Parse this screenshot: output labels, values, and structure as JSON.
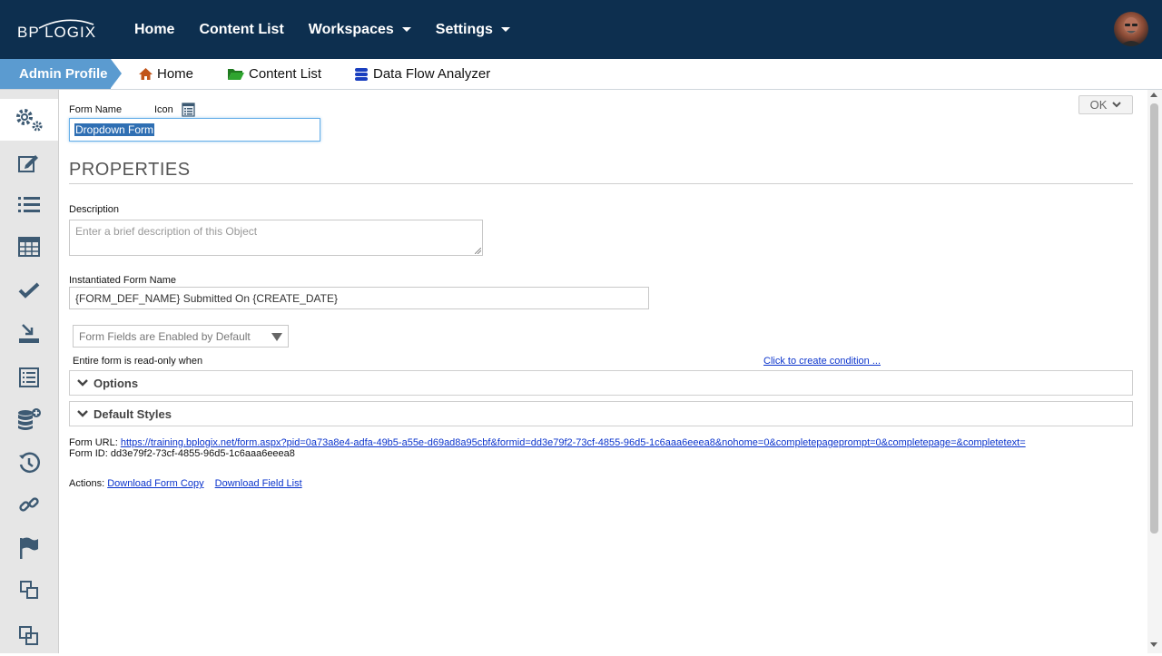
{
  "brand": {
    "logo_text": "BP LOGIX",
    "logo_icon": "bplogix-logo"
  },
  "topnav": {
    "items": [
      {
        "label": "Home",
        "has_caret": false
      },
      {
        "label": "Content List",
        "has_caret": false
      },
      {
        "label": "Workspaces",
        "has_caret": true
      },
      {
        "label": "Settings",
        "has_caret": true
      }
    ],
    "avatar_icon": "user-avatar"
  },
  "subnav": {
    "profile": "Admin Profile",
    "links": [
      {
        "label": "Home",
        "icon": "house-icon"
      },
      {
        "label": "Content List",
        "icon": "folder-icon"
      },
      {
        "label": "Data Flow Analyzer",
        "icon": "database-icon"
      }
    ]
  },
  "sidebar": {
    "icons": [
      "gears-icon",
      "edit-icon",
      "list-icon",
      "table-icon",
      "check-icon",
      "import-icon",
      "form-list-icon",
      "database-add-icon",
      "history-icon",
      "link-icon",
      "flag-icon",
      "window-restore-icon",
      "clone-icon"
    ]
  },
  "form": {
    "name_label": "Form Name",
    "icon_label": "Icon",
    "name_value": "Dropdown Form",
    "ok_label": "OK",
    "section_title": "PROPERTIES",
    "description_label": "Description",
    "description_placeholder": "Enter a brief description of this Object",
    "instantiated_label": "Instantiated Form Name",
    "instantiated_value": "{FORM_DEF_NAME} Submitted On {CREATE_DATE}",
    "fields_select": "Form Fields are Enabled by Default",
    "readonly_label": "Entire form is read-only when",
    "condition_link": "Click to create condition ...",
    "options_label": "Options",
    "styles_label": "Default Styles",
    "url_label": "Form URL:",
    "url_value": "https://training.bplogix.net/form.aspx?pid=0a73a8e4-adfa-49b5-a55e-d69ad8a95cbf&formid=dd3e79f2-73cf-4855-96d5-1c6aaa6eeea8&nohome=0&completepageprompt=0&completepage=&completetext=",
    "id_label": "Form ID:",
    "id_value": "dd3e79f2-73cf-4855-96d5-1c6aaa6eeea8",
    "actions_label": "Actions:",
    "action_download_copy": "Download Form Copy",
    "action_download_fields": "Download Field List"
  },
  "colors": {
    "topbar": "#0d2f4f",
    "profile_tab": "#5b9bd0",
    "link": "#0a33cc",
    "sidebar_icon": "#3d5a73"
  }
}
